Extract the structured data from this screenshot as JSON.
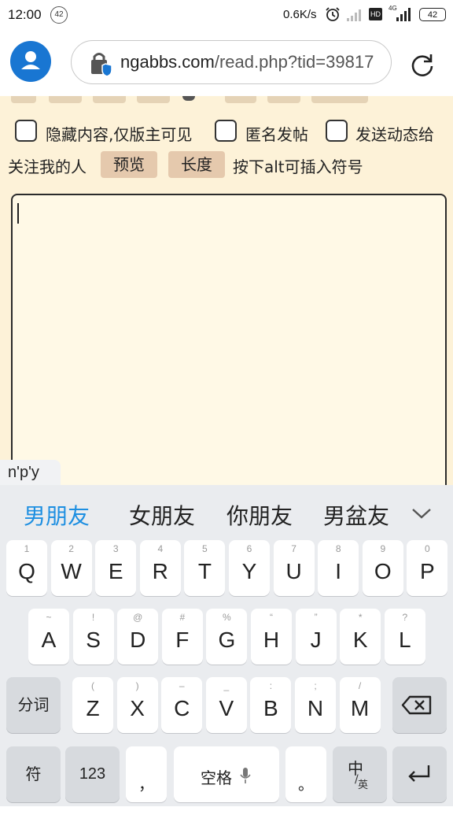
{
  "status_bar": {
    "time": "12:00",
    "notification_count": "42",
    "net_speed": "0.6K/s",
    "hd_badge": "HD",
    "network_type": "4G",
    "battery": "42"
  },
  "browser": {
    "url_domain": "ngabbs.com",
    "url_path": "/read.php?tid=39817"
  },
  "post_options": {
    "hide_content_label": "隐藏内容,仅版主可见",
    "anonymous_label": "匿名发帖",
    "send_activity_label": "发送动态给",
    "send_activity_label_cont": "关注我的人",
    "preview_button": "预览",
    "length_button": "长度",
    "alt_hint": "按下alt可插入符号"
  },
  "editor": {
    "content": ""
  },
  "ime": {
    "pinyin": "n'p'y",
    "candidates": [
      "男朋友",
      "女朋友",
      "你朋友",
      "男盆友"
    ],
    "row1": [
      {
        "hint": "1",
        "key": "Q"
      },
      {
        "hint": "2",
        "key": "W"
      },
      {
        "hint": "3",
        "key": "E"
      },
      {
        "hint": "4",
        "key": "R"
      },
      {
        "hint": "5",
        "key": "T"
      },
      {
        "hint": "6",
        "key": "Y"
      },
      {
        "hint": "7",
        "key": "U"
      },
      {
        "hint": "8",
        "key": "I"
      },
      {
        "hint": "9",
        "key": "O"
      },
      {
        "hint": "0",
        "key": "P"
      }
    ],
    "row2": [
      {
        "hint": "~",
        "key": "A"
      },
      {
        "hint": "!",
        "key": "S"
      },
      {
        "hint": "@",
        "key": "D"
      },
      {
        "hint": "#",
        "key": "F"
      },
      {
        "hint": "%",
        "key": "G"
      },
      {
        "hint": "“",
        "key": "H"
      },
      {
        "hint": "”",
        "key": "J"
      },
      {
        "hint": "*",
        "key": "K"
      },
      {
        "hint": "?",
        "key": "L"
      }
    ],
    "row3": [
      {
        "hint": "(",
        "key": "Z"
      },
      {
        "hint": ")",
        "key": "X"
      },
      {
        "hint": "–",
        "key": "C"
      },
      {
        "hint": "_",
        "key": "V"
      },
      {
        "hint": ":",
        "key": "B"
      },
      {
        "hint": ";",
        "key": "N"
      },
      {
        "hint": "/",
        "key": "M"
      }
    ],
    "segment_key": "分词",
    "symbol_key": "符",
    "number_key": "123",
    "comma_key": "，",
    "space_key": "空格",
    "period_key": "。",
    "lang_key_top": "中",
    "lang_key_bottom": "英"
  }
}
